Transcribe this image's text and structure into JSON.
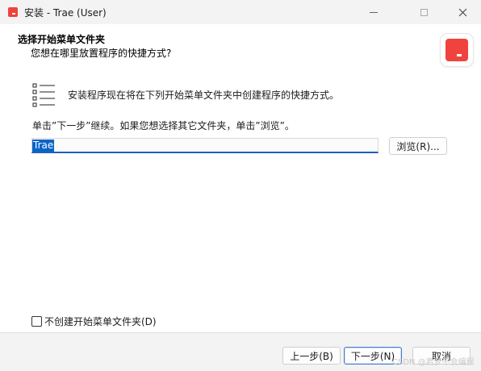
{
  "window": {
    "title": "安装 - Trae (User)",
    "accent_color": "#f0433d"
  },
  "header": {
    "title": "选择开始菜单文件夹",
    "subtitle": "您想在哪里放置程序的快捷方式?"
  },
  "content": {
    "intro": "安装程序现在将在下列开始菜单文件夹中创建程序的快捷方式。",
    "hint": "单击”下一步”继续。如果您想选择其它文件夹，单击”浏览”。",
    "folder_value": "Trae",
    "browse_label": "浏览(R)...",
    "no_folder_label": "不创建开始菜单文件夹(D)",
    "no_folder_checked": false
  },
  "footer": {
    "back_label": "上一步(B)",
    "next_label": "下一步(N)",
    "cancel_label": "取消",
    "watermark": "CSDN @君梦不会编程"
  },
  "icons": {
    "app": "trae-logo-icon",
    "list": "list-icon",
    "minimize": "minimize-icon",
    "maximize": "maximize-icon",
    "close": "close-icon"
  }
}
